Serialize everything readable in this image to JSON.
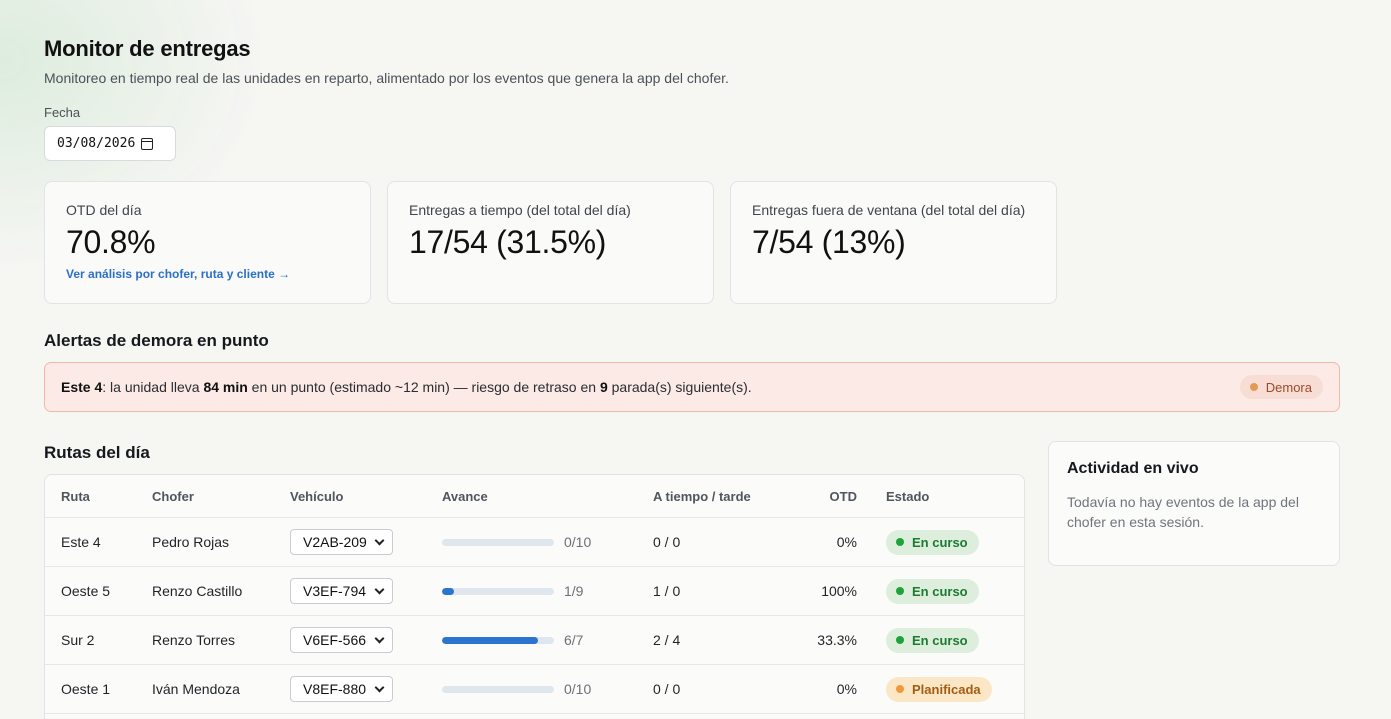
{
  "header": {
    "title": "Monitor de entregas",
    "subtitle": "Monitoreo en tiempo real de las unidades en reparto, alimentado por los eventos que genera la app del chofer."
  },
  "date": {
    "label": "Fecha",
    "value": "03/08/2026"
  },
  "kpis": [
    {
      "label": "OTD del día",
      "value": "70.8%",
      "link": "Ver análisis por chofer, ruta y cliente →"
    },
    {
      "label": "Entregas a tiempo (del total del día)",
      "value": "17/54 (31.5%)"
    },
    {
      "label": "Entregas fuera de ventana (del total del día)",
      "value": "7/54 (13%)"
    }
  ],
  "alerts": {
    "heading": "Alertas de demora en punto",
    "items": [
      {
        "route": "Este 4",
        "t1": ": la unidad lleva ",
        "minutes": "84 min",
        "t2": " en un punto (estimado ~12 min) — riesgo de retraso en ",
        "count": "9",
        "t3": " parada(s) siguiente(s).",
        "badge": "Demora",
        "badge_color": "#e39a52"
      }
    ]
  },
  "routes": {
    "heading": "Rutas del día",
    "columns": {
      "ruta": "Ruta",
      "chofer": "Chofer",
      "vehiculo": "Vehículo",
      "avance": "Avance",
      "tiempo": "A tiempo / tarde",
      "otd": "OTD",
      "estado": "Estado"
    },
    "rows": [
      {
        "ruta": "Este 4",
        "chofer": "Pedro Rojas",
        "vehiculo": "V2AB-209",
        "progress": 0.0,
        "avance": "0/10",
        "tiempo": "0 / 0",
        "otd": "0%",
        "estado": "En curso",
        "estado_kind": "ok"
      },
      {
        "ruta": "Oeste 5",
        "chofer": "Renzo Castillo",
        "vehiculo": "V3EF-794",
        "progress": 0.111,
        "avance": "1/9",
        "tiempo": "1 / 0",
        "otd": "100%",
        "estado": "En curso",
        "estado_kind": "ok"
      },
      {
        "ruta": "Sur 2",
        "chofer": "Renzo Torres",
        "vehiculo": "V6EF-566",
        "progress": 0.857,
        "avance": "6/7",
        "tiempo": "2 / 4",
        "otd": "33.3%",
        "estado": "En curso",
        "estado_kind": "ok"
      },
      {
        "ruta": "Oeste 1",
        "chofer": "Iván Mendoza",
        "vehiculo": "V8EF-880",
        "progress": 0.0,
        "avance": "0/10",
        "tiempo": "0 / 0",
        "otd": "0%",
        "estado": "Planificada",
        "estado_kind": "plan"
      }
    ]
  },
  "activity": {
    "title": "Actividad en vivo",
    "body": "Todavía no hay eventos de la app del chofer en esta sesión."
  },
  "colors": {
    "ok": "#1ea33a",
    "plan": "#ee9a3a",
    "accent": "#2b74cf"
  }
}
